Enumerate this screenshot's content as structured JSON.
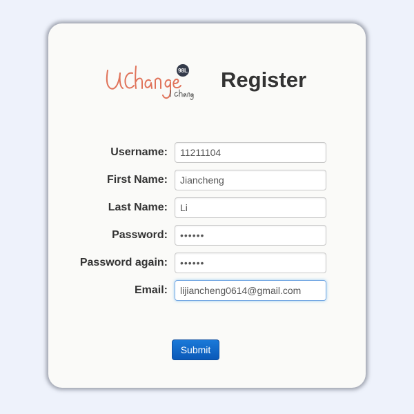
{
  "header": {
    "title": "Register",
    "logo_alt": "UChange I change 98L"
  },
  "form": {
    "fields": [
      {
        "label": "Username:",
        "value": "11211104",
        "type": "text"
      },
      {
        "label": "First Name:",
        "value": "Jiancheng",
        "type": "text"
      },
      {
        "label": "Last Name:",
        "value": "Li",
        "type": "text"
      },
      {
        "label": "Password:",
        "value": "••••••",
        "type": "password"
      },
      {
        "label": "Password again:",
        "value": "••••••",
        "type": "password"
      },
      {
        "label": "Email:",
        "value": "lijiancheng0614@gmail.com",
        "type": "text",
        "focused": true
      }
    ],
    "submit_label": "Submit"
  },
  "colors": {
    "page_background": "#eef2fb",
    "card_background": "#fafaf8",
    "logo_text": "#e0735a",
    "button": "#0b59b8",
    "focus_border": "#76a9e3"
  }
}
